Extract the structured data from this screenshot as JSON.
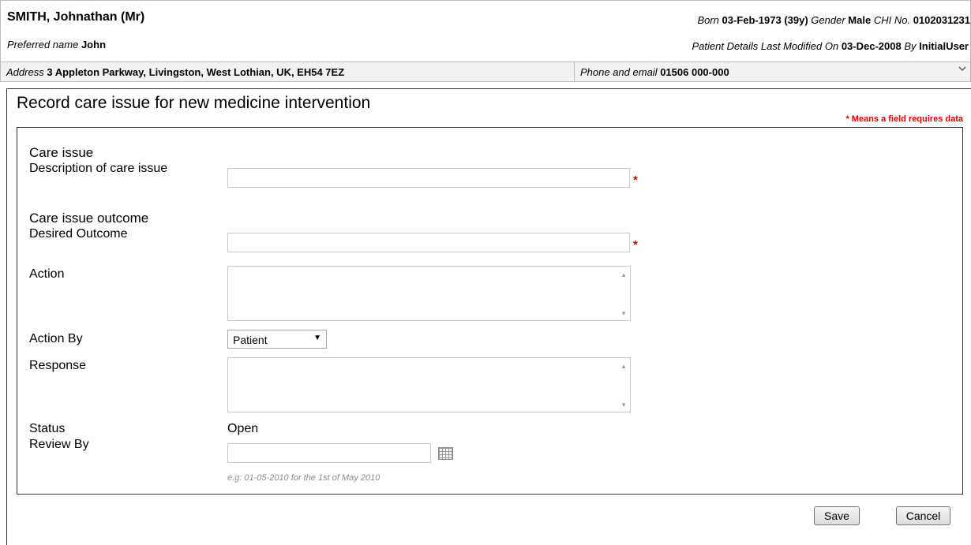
{
  "patient": {
    "name": "SMITH, Johnathan (Mr)",
    "preferred_label": "Preferred name",
    "preferred_name": "John",
    "born_label": "Born",
    "born": "03-Feb-1973",
    "age": "(39y)",
    "gender_label": "Gender",
    "gender": "Male",
    "chi_label": "CHI No.",
    "chi": "0102031231",
    "modified_label": "Patient Details Last Modified On",
    "modified_on": "03-Dec-2008",
    "by_label": "By",
    "modified_by": "InitialUser",
    "address_label": "Address",
    "address": "3 Appleton Parkway, Livingston, West Lothian, UK, EH54 7EZ",
    "phone_label": "Phone and email",
    "phone": "01506 000-000",
    "expand_icon": "chevron-down-icon"
  },
  "form": {
    "title": "Record care issue for new medicine intervention",
    "required_note": "* Means a field requires data",
    "care_issue_heading": "Care issue",
    "description_label": "Description of care issue",
    "description_value": "",
    "required_star": "*",
    "outcome_heading": "Care issue outcome",
    "desired_outcome_label": "Desired Outcome",
    "desired_outcome_value": "",
    "action_label": "Action",
    "action_value": "",
    "action_by_label": "Action By",
    "action_by_value": "Patient",
    "response_label": "Response",
    "response_value": "",
    "status_label": "Status",
    "status_value": "Open",
    "review_by_label": "Review By",
    "review_by_value": "",
    "review_hint": "e.g: 01-05-2010 for the 1st of May 2010",
    "calendar_icon": "calendar-icon"
  },
  "buttons": {
    "save": "Save",
    "cancel": "Cancel"
  },
  "colors": {
    "required": "#e00000",
    "banner_bar": "#f2f2f2"
  }
}
